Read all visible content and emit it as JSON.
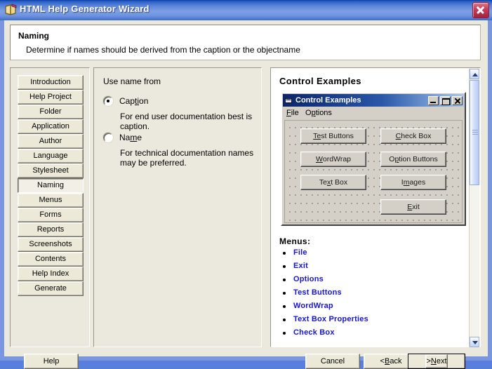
{
  "window": {
    "title": "HTML Help Generator Wizard",
    "title_icon": "book-icon",
    "close_icon": "close-icon",
    "accent_titlebar": "#5c86db",
    "accent_close": "#c8415c",
    "client_bg": "#ebe9dd"
  },
  "header": {
    "title": "Naming",
    "subtitle": "Determine if names should be derived from the caption or the objectname"
  },
  "sidebar": {
    "items": [
      {
        "label": "Introduction",
        "selected": false
      },
      {
        "label": "Help Project",
        "selected": false
      },
      {
        "label": "Folder",
        "selected": false
      },
      {
        "label": "Application",
        "selected": false
      },
      {
        "label": "Author",
        "selected": false
      },
      {
        "label": "Language",
        "selected": false
      },
      {
        "label": "Stylesheet",
        "selected": false
      },
      {
        "label": "Naming",
        "selected": true
      },
      {
        "label": "Menus",
        "selected": false
      },
      {
        "label": "Forms",
        "selected": false
      },
      {
        "label": "Reports",
        "selected": false
      },
      {
        "label": "Screenshots",
        "selected": false
      },
      {
        "label": "Contents",
        "selected": false
      },
      {
        "label": "Help Index",
        "selected": false
      },
      {
        "label": "Generate",
        "selected": false
      }
    ]
  },
  "options": {
    "group_label": "Use name from",
    "radios": [
      {
        "label": "Caption",
        "accel_pre": "Cap",
        "accel": "ti",
        "accel_post": "on",
        "selected": true,
        "description": "For end user documentation best is caption."
      },
      {
        "label": "Name",
        "accel_pre": "Na",
        "accel": "m",
        "accel_post": "e",
        "selected": false,
        "description": "For technical documentation names may be preferred."
      }
    ]
  },
  "preview": {
    "heading": "Control Examples",
    "form": {
      "title": "Control Examples",
      "title_icon": "form-window-icon",
      "minimize_icon": "minimize-icon",
      "maximize_icon": "maximize-icon",
      "close_icon": "close-icon",
      "menus": [
        {
          "label": "File",
          "accel_pre": "",
          "accel": "F",
          "accel_post": "ile"
        },
        {
          "label": "Options",
          "accel_pre": "O",
          "accel": "p",
          "accel_post": "tions"
        }
      ],
      "buttons_left": [
        {
          "label": "Test Buttons",
          "accel_pre": "",
          "accel": "Te",
          "accel_post": "st Buttons"
        },
        {
          "label": "WordWrap",
          "accel_pre": "",
          "accel": "W",
          "accel_post": "ordWrap"
        },
        {
          "label": "Text Box",
          "accel_pre": "Te",
          "accel": "x",
          "accel_post": "t Box"
        }
      ],
      "buttons_right": [
        {
          "label": "Check Box",
          "accel_pre": "",
          "accel": "C",
          "accel_post": "heck Box"
        },
        {
          "label": "Option Buttons",
          "accel_pre": "O",
          "accel": "p",
          "accel_post": "tion Buttons"
        },
        {
          "label": "Images",
          "accel_pre": "I",
          "accel": "m",
          "accel_post": "ages"
        }
      ],
      "button_exit": {
        "label": "Exit",
        "accel_pre": "",
        "accel": "E",
        "accel_post": "xit"
      }
    },
    "menus_heading": "Menus:",
    "menus_list": [
      "File",
      "Exit",
      "Options",
      "Test Buttons",
      "WordWrap",
      "Text Box Properties",
      "Check Box"
    ],
    "scrollbar": {
      "up_icon": "scroll-up-arrow-icon",
      "down_icon": "scroll-down-arrow-icon"
    }
  },
  "footer": {
    "help": {
      "label": "Help",
      "accel_pre": "Help",
      "accel": "",
      "accel_post": ""
    },
    "cancel": {
      "label": "Cancel",
      "accel_pre": "Cancel",
      "accel": "",
      "accel_post": ""
    },
    "back": {
      "label": "< Back",
      "accel_pre": "< ",
      "accel": "B",
      "accel_post": "ack"
    },
    "next": {
      "label": "> Next",
      "accel_pre": "> ",
      "accel": "N",
      "accel_post": "ext"
    }
  }
}
